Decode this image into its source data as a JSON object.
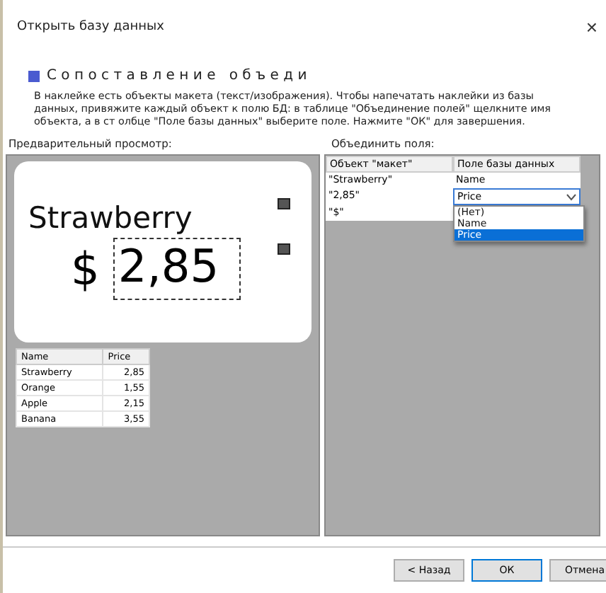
{
  "window": {
    "title": "Открыть базу данных",
    "close": "×"
  },
  "heading": "Сопоставление объеди",
  "description": "В наклейке есть объекты макета (текст/изображения). Чтобы напечатать наклейки из базы данных, привяжите каждый объект к полю БД: в таблице \"Объединение полей\" щелкните имя объекта, а в ст олбце \"Поле базы данных\" выберите поле. Нажмите \"ОК\" для завершения.",
  "preview": {
    "label": "Предварительный просмотр:",
    "label_text": "Strawberry",
    "currency": "$",
    "price": "2,85",
    "table": {
      "columns": [
        "Name",
        "Price"
      ],
      "rows": [
        [
          "Strawberry",
          "2,85"
        ],
        [
          "Orange",
          "1,55"
        ],
        [
          "Apple",
          "2,15"
        ],
        [
          "Banana",
          "3,55"
        ]
      ]
    }
  },
  "merge": {
    "label": "Объединить поля:",
    "columns": [
      "Объект \"макет\"",
      "Поле базы данных"
    ],
    "rows": [
      {
        "object": "\"Strawberry\"",
        "field": "Name",
        "editing": false
      },
      {
        "object": "\"2,85\"",
        "field": "Price",
        "editing": true
      },
      {
        "object": "\"$\"",
        "field": "",
        "editing": false
      }
    ],
    "options": [
      {
        "label": "(Нет)",
        "selected": false
      },
      {
        "label": "Name",
        "selected": false
      },
      {
        "label": "Price",
        "selected": true
      }
    ]
  },
  "buttons": [
    {
      "label": "< Назад",
      "default": false
    },
    {
      "label": "ОК",
      "default": true
    },
    {
      "label": "Отмена",
      "default": false
    }
  ]
}
